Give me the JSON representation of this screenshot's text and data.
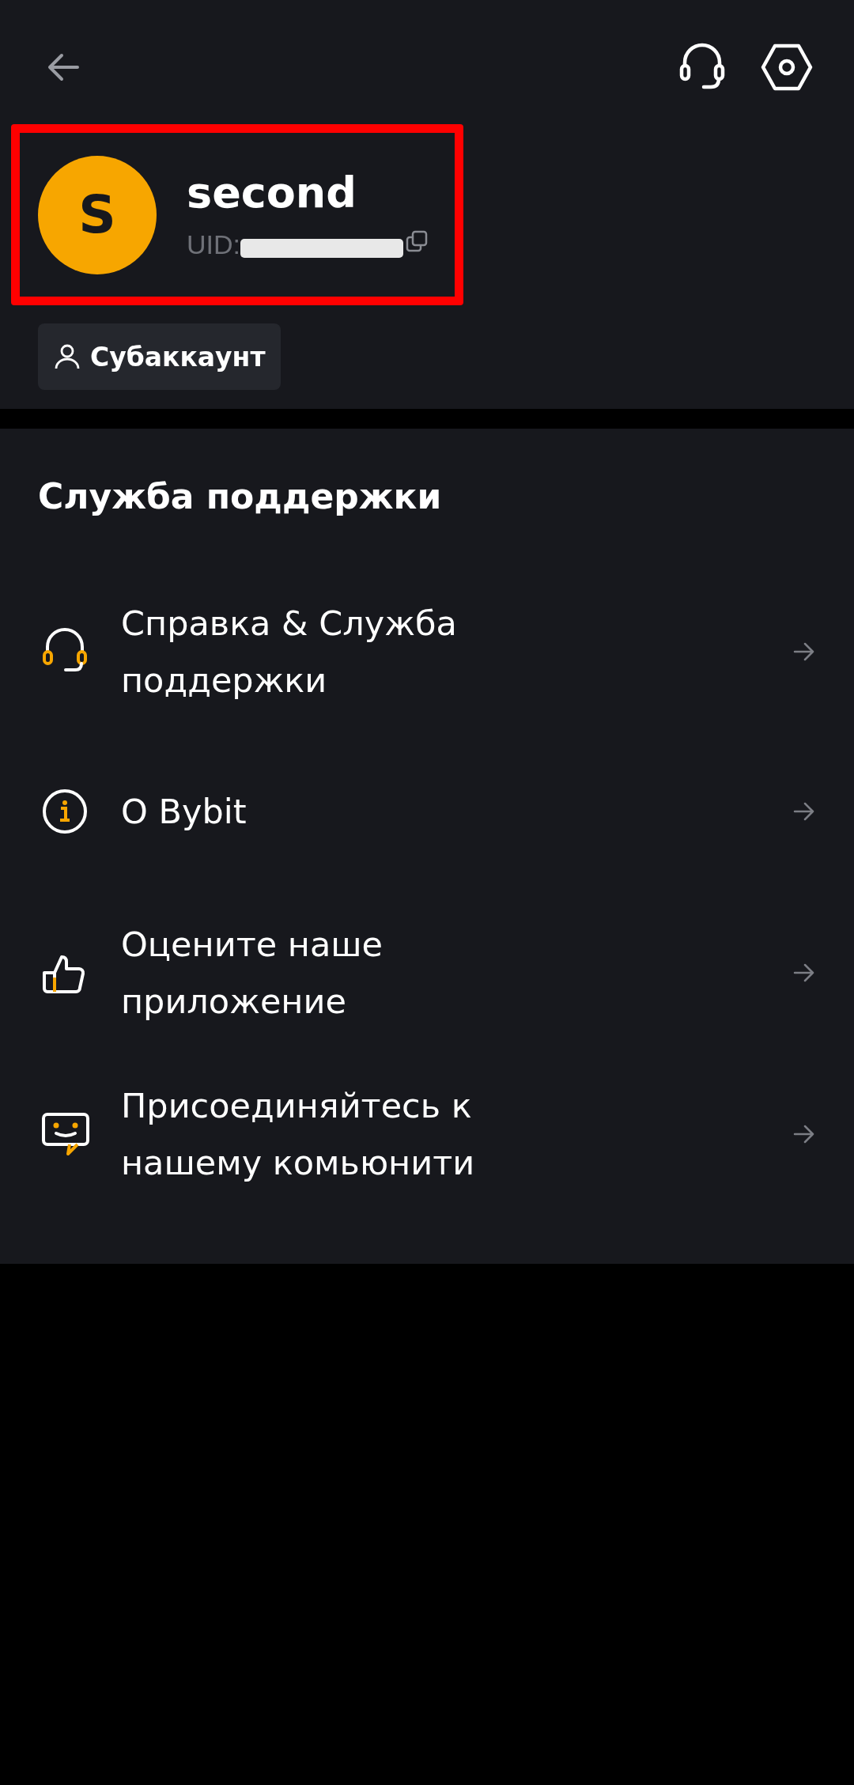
{
  "profile": {
    "avatar_letter": "S",
    "name": "second",
    "uid_label": "UID:",
    "uid_redacted": true,
    "highlighted": true,
    "account_type": "Субаккаунт"
  },
  "support": {
    "title": "Служба поддержки",
    "items": [
      {
        "label": "Справка & Служба поддержки"
      },
      {
        "label": "О Bybit"
      },
      {
        "label": "Оцените наше приложение"
      },
      {
        "label": "Присоединяйтесь к нашему комьюнити"
      }
    ]
  }
}
